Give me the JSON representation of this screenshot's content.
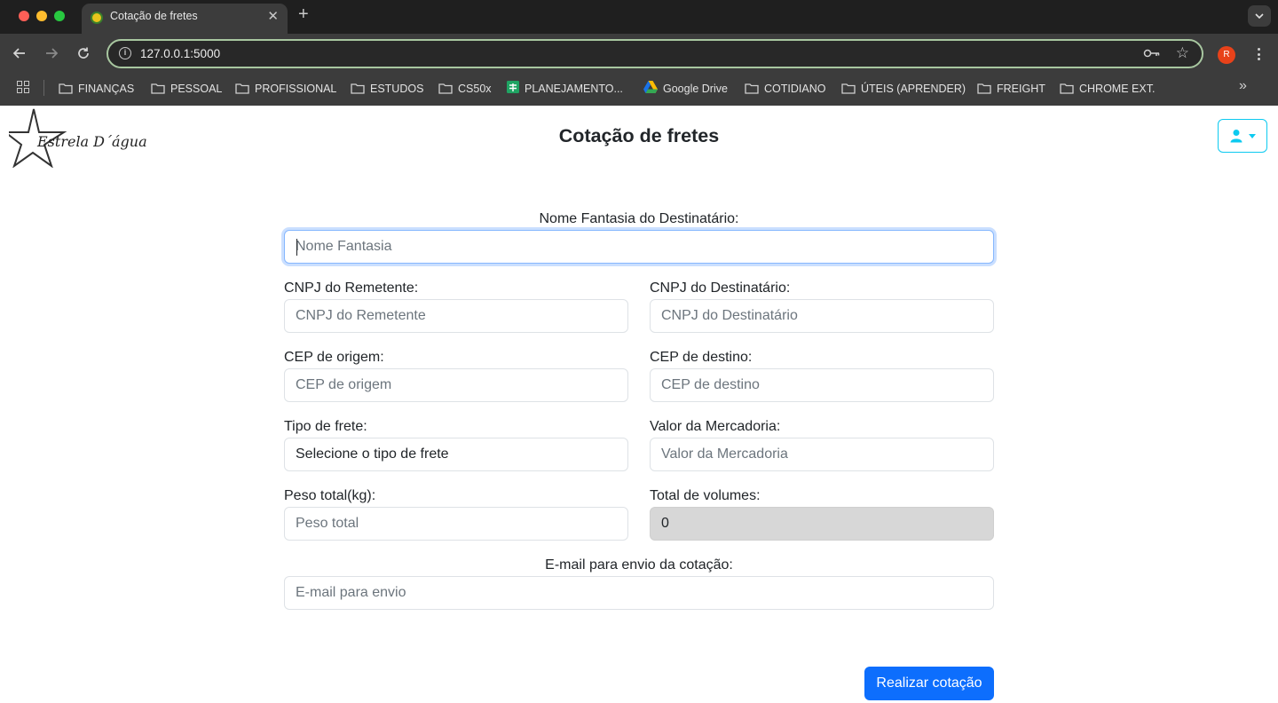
{
  "browser": {
    "tab_title": "Cotação de fretes",
    "tab_close": "✕",
    "new_tab": "+",
    "url": "127.0.0.1:5000",
    "profile_initial": "R",
    "bookmarks": [
      {
        "label": "FINANÇAS",
        "icon": "folder-icon"
      },
      {
        "label": "PESSOAL",
        "icon": "folder-icon"
      },
      {
        "label": "PROFISSIONAL",
        "icon": "folder-icon"
      },
      {
        "label": "ESTUDOS",
        "icon": "folder-icon"
      },
      {
        "label": "CS50x",
        "icon": "folder-icon"
      },
      {
        "label": "PLANEJAMENTO...",
        "icon": "sheets-icon"
      },
      {
        "label": "Google Drive",
        "icon": "google-drive-icon"
      },
      {
        "label": "COTIDIANO",
        "icon": "folder-icon"
      },
      {
        "label": "ÚTEIS (APRENDER)",
        "icon": "folder-icon"
      },
      {
        "label": "FREIGHT",
        "icon": "folder-icon"
      },
      {
        "label": "CHROME EXT.",
        "icon": "folder-icon"
      }
    ],
    "overflow": "»"
  },
  "header": {
    "logo_text": "Estrela D´água",
    "title": "Cotação de fretes"
  },
  "form": {
    "nome_fantasia": {
      "label": "Nome Fantasia do Destinatário:",
      "placeholder": "Nome Fantasia"
    },
    "cnpj_remetente": {
      "label": "CNPJ do Remetente:",
      "placeholder": "CNPJ do Remetente"
    },
    "cnpj_destinatario": {
      "label": "CNPJ do Destinatário:",
      "placeholder": "CNPJ do Destinatário"
    },
    "cep_origem": {
      "label": "CEP de origem:",
      "placeholder": "CEP de origem"
    },
    "cep_destino": {
      "label": "CEP de destino:",
      "placeholder": "CEP de destino"
    },
    "tipo_frete": {
      "label": "Tipo de frete:",
      "value": "Selecione o tipo de frete"
    },
    "valor_mercadoria": {
      "label": "Valor da Mercadoria:",
      "placeholder": "Valor da Mercadoria"
    },
    "peso_total": {
      "label": "Peso total(kg):",
      "placeholder": "Peso total"
    },
    "total_volumes": {
      "label": "Total de volumes:",
      "value": "0"
    },
    "email": {
      "label": "E-mail para envio da cotação:",
      "placeholder": "E-mail para envio"
    },
    "submit_label": "Realizar cotação"
  },
  "colors": {
    "primary": "#0d6efd",
    "info_outline": "#0dcaf0",
    "focus_ring": "#86b7fe",
    "readonly_bg": "#d7d7d7"
  }
}
